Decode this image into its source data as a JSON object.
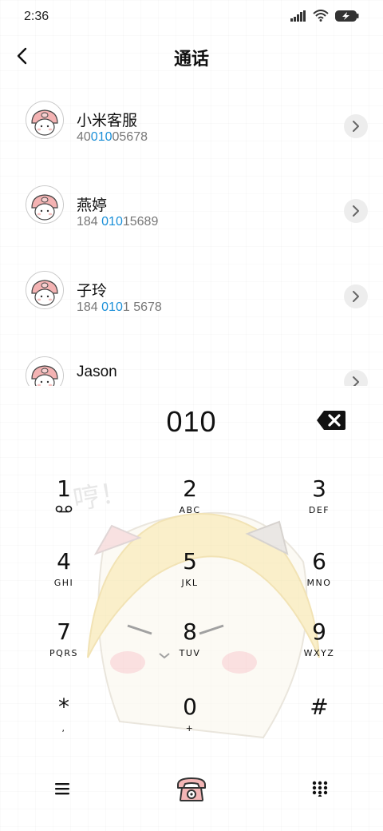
{
  "status_bar": {
    "time": "2:36"
  },
  "header": {
    "title": "通话"
  },
  "contacts": [
    {
      "name": "小米客服",
      "number_pre": "40",
      "number_match": "010",
      "number_post": "05678"
    },
    {
      "name": "燕婷",
      "number_pre": "184 ",
      "number_match": "010",
      "number_post": "15689"
    },
    {
      "name": "子玲",
      "number_pre": "184 ",
      "number_match": "010",
      "number_post": "1 5678"
    },
    {
      "name": "Jason",
      "number_pre": "",
      "number_match": "",
      "number_post": ""
    }
  ],
  "dialer": {
    "input": "010",
    "keys": [
      {
        "digit": "1",
        "sub": ""
      },
      {
        "digit": "2",
        "sub": "ABC"
      },
      {
        "digit": "3",
        "sub": "DEF"
      },
      {
        "digit": "4",
        "sub": "GHI"
      },
      {
        "digit": "5",
        "sub": "JKL"
      },
      {
        "digit": "6",
        "sub": "MNO"
      },
      {
        "digit": "7",
        "sub": "PQRS"
      },
      {
        "digit": "8",
        "sub": "TUV"
      },
      {
        "digit": "9",
        "sub": "WXYZ"
      },
      {
        "digit": "*",
        "sub": ","
      },
      {
        "digit": "0",
        "sub": "+"
      },
      {
        "digit": "#",
        "sub": ""
      }
    ],
    "decoration_text": "哼！"
  },
  "colors": {
    "highlight": "#1a8fd8",
    "call_button": "#e58a8a"
  }
}
